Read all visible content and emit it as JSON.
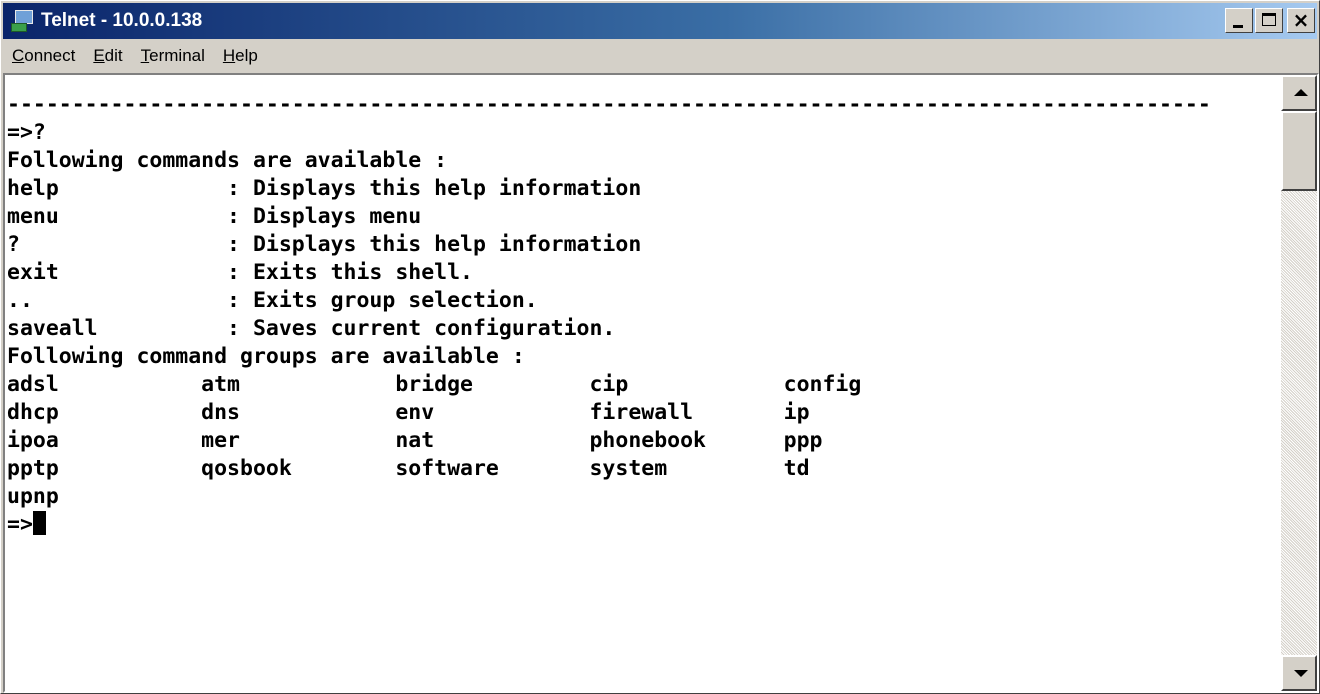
{
  "window": {
    "title": "Telnet - 10.0.0.138",
    "icon": "telnet-icon",
    "titlebar_color": "#0a246a"
  },
  "menu": [
    {
      "key": "C",
      "rest": "onnect"
    },
    {
      "key": "E",
      "rest": "dit"
    },
    {
      "key": "T",
      "rest": "erminal"
    },
    {
      "key": "H",
      "rest": "elp"
    }
  ],
  "terminal": {
    "lines": [
      "---------------------------------------------------------------------------------------------",
      "=>?",
      "Following commands are available :",
      "",
      "help             : Displays this help information",
      "menu             : Displays menu",
      "?                : Displays this help information",
      "exit             : Exits this shell.",
      "..               : Exits group selection.",
      "saveall          : Saves current configuration.",
      "",
      "Following command groups are available :",
      "",
      "adsl           atm            bridge         cip            config",
      "dhcp           dns            env            firewall       ip",
      "ipoa           mer            nat            phonebook      ppp",
      "pptp           qosbook        software       system         td",
      "upnp",
      ""
    ],
    "prompt": "=>"
  }
}
